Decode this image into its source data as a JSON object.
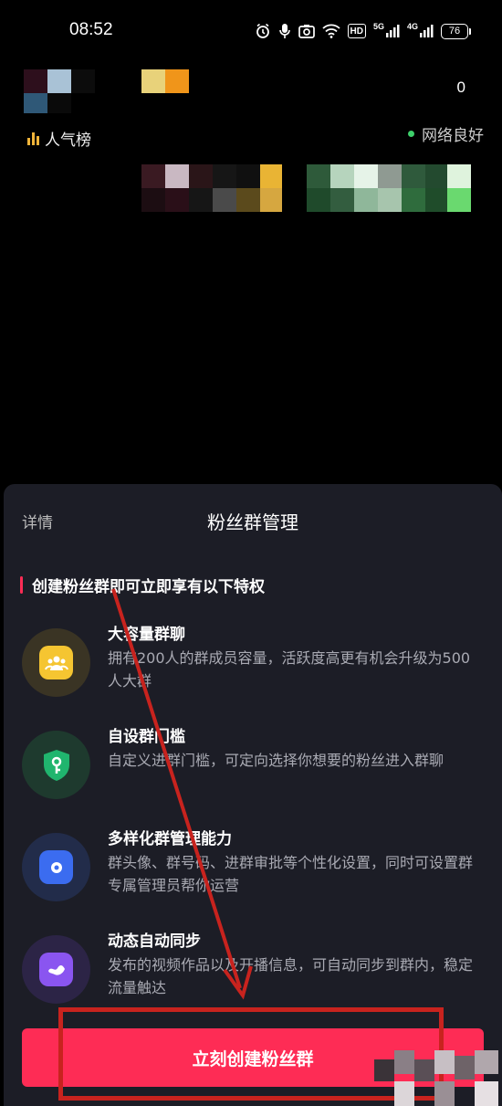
{
  "status_bar": {
    "time": "08:52",
    "hd_badge": "HD",
    "net1_label": "5G",
    "net2_label": "4G",
    "battery": "76",
    "icons": [
      "alarm-icon",
      "mic-icon",
      "camera-icon",
      "wifi-icon",
      "signal-icon",
      "signal-icon",
      "battery-icon"
    ]
  },
  "live_header": {
    "viewer_count": "0",
    "rank_label": "人气榜",
    "network_status": "网络良好"
  },
  "sheet": {
    "details_tab": "详情",
    "title": "粉丝群管理",
    "section_title": "创建粉丝群即可立即享有以下特权",
    "features": [
      {
        "title": "大容量群聊",
        "description": "拥有200人的群成员容量，活跃度高更有机会升级为500人大群",
        "icon": "group-icon",
        "color": "#f5c531"
      },
      {
        "title": "自设群门槛",
        "description": "自定义进群门槛，可定向选择你想要的粉丝进入群聊",
        "icon": "key-shield-icon",
        "color": "#20b56e"
      },
      {
        "title": "多样化群管理能力",
        "description": "群头像、群号码、进群审批等个性化设置，同时可设置群专属管理员帮你运营",
        "icon": "settings-icon",
        "color": "#3b6cf0"
      },
      {
        "title": "动态自动同步",
        "description": "发布的视频作品以及开播信息，可自动同步到群内，稳定流量触达",
        "icon": "sync-icon",
        "color": "#8a55f0"
      }
    ],
    "create_button": "立刻创建粉丝群"
  },
  "colors": {
    "accent": "#fe2c55",
    "sheet_bg": "#1c1d26",
    "annotation": "#c8231e"
  }
}
